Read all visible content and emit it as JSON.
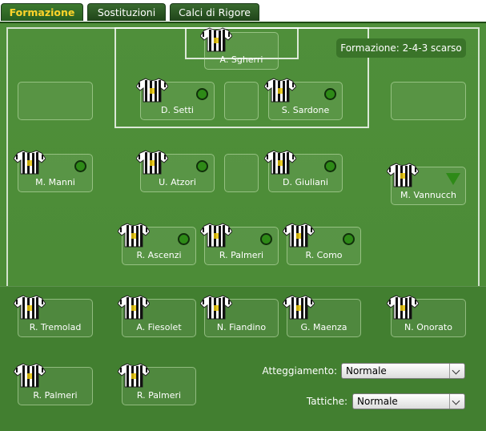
{
  "tabs": [
    {
      "label": "Formazione",
      "active": true
    },
    {
      "label": "Sostituzioni",
      "active": false
    },
    {
      "label": "Calci di Rigore",
      "active": false
    }
  ],
  "formation_label": "Formazione: 2-4-3 scarso",
  "players": {
    "goalkeeper": {
      "name": "A. Sgherri"
    },
    "setti": {
      "name": "D. Setti",
      "status": "ok"
    },
    "sardone": {
      "name": "S. Sardone",
      "status": "ok"
    },
    "manni": {
      "name": "M. Manni",
      "status": "ok"
    },
    "atzori": {
      "name": "U. Atzori",
      "status": "ok"
    },
    "giuliani": {
      "name": "D. Giuliani",
      "status": "ok"
    },
    "vannucch": {
      "name": "M. Vannucch",
      "status": "down"
    },
    "ascenzi": {
      "name": "R. Ascenzi",
      "status": "ok"
    },
    "palmeri_mid": {
      "name": "R. Palmeri",
      "status": "ok"
    },
    "como": {
      "name": "R. Como",
      "status": "ok"
    }
  },
  "bench": [
    {
      "name": "R. Tremolad"
    },
    {
      "name": "A. Fiesolet"
    },
    {
      "name": "N. Fiandino"
    },
    {
      "name": "G. Maenza"
    },
    {
      "name": "N. Onorato"
    },
    {
      "name": "R. Palmeri"
    },
    {
      "name": "R. Palmeri"
    }
  ],
  "controls": {
    "attitude_label": "Atteggiamento:",
    "attitude_value": "Normale",
    "tactics_label": "Tattiche:",
    "tactics_value": "Normale"
  },
  "colors": {
    "pitch": "#4f8f3a",
    "status_ok": "#2e8a17",
    "active_tab_text": "#ffd42a"
  }
}
